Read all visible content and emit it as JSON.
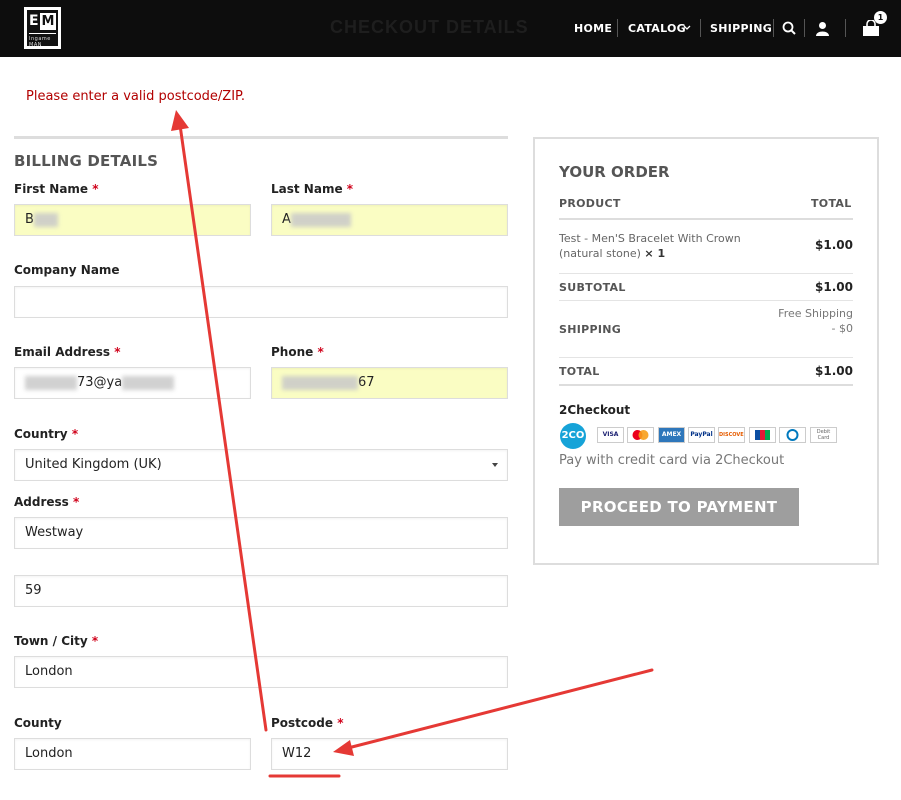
{
  "header": {
    "logo_text": "EM",
    "logo_subtext": "Ingame MAN",
    "ghost_title": "CHECKOUT DETAILS",
    "nav": {
      "home": "HOME",
      "catalog": "CATALOG",
      "shipping": "SHIPPING"
    },
    "cart_count": "1",
    "icons": [
      "search-icon",
      "user-icon",
      "cart-icon",
      "chevron-down-icon"
    ]
  },
  "error_message": "Please enter a valid postcode/ZIP.",
  "billing": {
    "title": "BILLING DETAILS",
    "first_name": {
      "label": "First Name",
      "value": "B"
    },
    "last_name": {
      "label": "Last Name",
      "value": "A"
    },
    "company": {
      "label": "Company Name",
      "value": ""
    },
    "email": {
      "label": "Email Address",
      "value": "73@ya"
    },
    "phone": {
      "label": "Phone",
      "value": "67"
    },
    "country": {
      "label": "Country",
      "value": "United Kingdom (UK)"
    },
    "address": {
      "label": "Address",
      "line1": "Westway",
      "line2": "59"
    },
    "city": {
      "label": "Town / City",
      "value": "London"
    },
    "county": {
      "label": "County",
      "value": "London"
    },
    "postcode": {
      "label": "Postcode",
      "value": "W12"
    },
    "required_mark": "*"
  },
  "order": {
    "title": "YOUR ORDER",
    "col_product": "PRODUCT",
    "col_total": "TOTAL",
    "item_name": "Test - Men'S Bracelet With Crown (natural stone)",
    "item_qty": "× 1",
    "item_total": "$1.00",
    "subtotal_label": "SUBTOTAL",
    "subtotal_value": "$1.00",
    "shipping_label": "SHIPPING",
    "shipping_value": "Free Shipping - $0",
    "total_label": "TOTAL",
    "total_value": "$1.00",
    "payment_method": "2Checkout",
    "payment_logo": "2CO",
    "cards": [
      "VISA",
      "MC",
      "AMEX",
      "PayPal",
      "DISCOVER",
      "JCB",
      "Diners",
      "Debit Card"
    ],
    "payment_desc": "Pay with credit card via 2Checkout",
    "button": "PROCEED TO PAYMENT"
  },
  "colors": {
    "header_bg": "#0d0d0d",
    "error": "#b20000",
    "highlight_field": "#fafdc3",
    "button_bg": "#9e9e9e",
    "annotation": "#e53935"
  }
}
